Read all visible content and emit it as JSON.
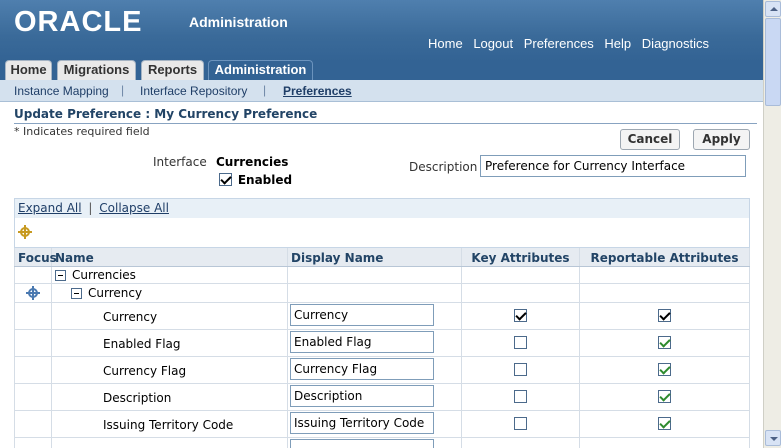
{
  "brand": {
    "logo": "ORACLE",
    "app_title": "Administration",
    "links": [
      "Home",
      "Logout",
      "Preferences",
      "Help",
      "Diagnostics"
    ]
  },
  "tabs": [
    "Home",
    "Migrations",
    "Reports",
    "Administration"
  ],
  "subtabs": [
    "Instance Mapping",
    "Interface Repository",
    "Preferences"
  ],
  "page": {
    "title": "Update Preference : My Currency Preference",
    "required_note": "* Indicates required field",
    "cancel_label": "Cancel",
    "apply_label": "Apply",
    "interface_label": "Interface",
    "interface_value": "Currencies",
    "enabled_label": "Enabled",
    "enabled_checked": true,
    "description_label": "Description",
    "description_value": "Preference for Currency Interface"
  },
  "tree": {
    "expand_all": "Expand All",
    "separator": "|",
    "collapse_all": "Collapse All",
    "headers": {
      "focus": "Focus",
      "name": "Name",
      "display_name": "Display Name",
      "key_attributes": "Key Attributes",
      "reportable_attributes": "Reportable Attributes"
    },
    "root_node": "Currencies",
    "child_node": "Currency",
    "rows": [
      {
        "name": "Currency",
        "display": "Currency",
        "key": true,
        "reportable": true
      },
      {
        "name": "Enabled Flag",
        "display": "Enabled Flag",
        "key": false,
        "reportable": true
      },
      {
        "name": "Currency Flag",
        "display": "Currency Flag",
        "key": false,
        "reportable": true
      },
      {
        "name": "Description",
        "display": "Description",
        "key": false,
        "reportable": true
      },
      {
        "name": "Issuing Territory Code",
        "display": "Issuing Territory Code",
        "key": false,
        "reportable": true
      }
    ]
  }
}
